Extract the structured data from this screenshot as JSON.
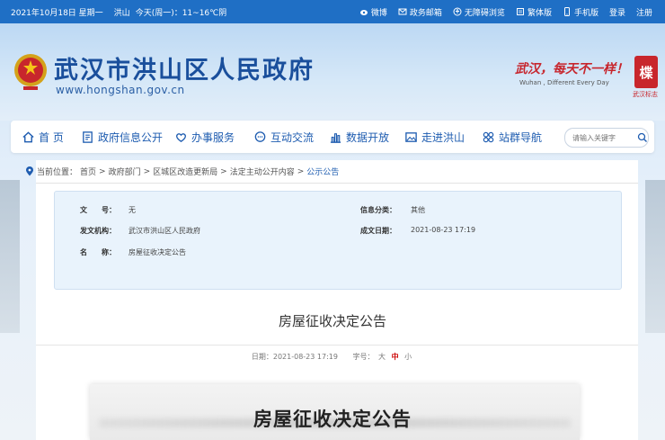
{
  "topbar": {
    "date": "2021年10月18日 星期一",
    "city": "洪山",
    "weather": "今天(周一)：11~16℃阴",
    "links": [
      {
        "label": "微博",
        "icon": "weibo-icon"
      },
      {
        "label": "政务邮箱",
        "icon": "mail-icon"
      },
      {
        "label": "无障碍浏览",
        "icon": "accessibility-icon"
      },
      {
        "label": "繁体版",
        "icon": "traditional-icon"
      },
      {
        "label": "手机版",
        "icon": "mobile-icon"
      },
      {
        "label": "登录",
        "icon": ""
      },
      {
        "label": "注册",
        "icon": ""
      }
    ]
  },
  "header": {
    "title": "武汉市洪山区人民政府",
    "url": "www.hongshan.gov.cn",
    "slogan": "武汉，每天不一样！",
    "slogan_en": "Wuhan , Different Every Day",
    "seal_char": "楪",
    "seal_label": "武汉标志"
  },
  "nav": {
    "items": [
      {
        "label": "首 页",
        "icon": "home-icon"
      },
      {
        "label": "政府信息公开",
        "icon": "document-icon"
      },
      {
        "label": "办事服务",
        "icon": "heart-hands-icon"
      },
      {
        "label": "互动交流",
        "icon": "chat-icon"
      },
      {
        "label": "数据开放",
        "icon": "bar-chart-icon"
      },
      {
        "label": "走进洪山",
        "icon": "image-icon"
      },
      {
        "label": "站群导航",
        "icon": "grid-icon"
      }
    ],
    "search_placeholder": "请输入关键字"
  },
  "breadcrumb": {
    "prefix": "当前位置：",
    "items": [
      "首页",
      "政府部门",
      "区城区改造更新局",
      "法定主动公开内容",
      "公示公告"
    ],
    "separator": ">"
  },
  "info": {
    "doc_no_label": "文　　号：",
    "doc_no": "无",
    "category_label": "信息分类：",
    "category": "其他",
    "issuer_label": "发文机构：",
    "issuer": "武汉市洪山区人民政府",
    "date_label": "成文日期：",
    "date": "2021-08-23 17:19",
    "name_label": "名　　称：",
    "name": "房屋征收决定公告"
  },
  "article": {
    "title": "房屋征收决定公告",
    "date_label": "日期：",
    "date": "2021-08-23 17:19",
    "font_label": "字号：",
    "font_large": "大",
    "font_medium": "中",
    "font_small": "小",
    "scan_title": "房屋征收决定公告"
  },
  "colors": {
    "topbar": "#1f6fc5",
    "title": "#1a4f9c",
    "nav_text": "#1e5cb0",
    "slogan": "#c7262d",
    "active_font": "#cc0000"
  }
}
